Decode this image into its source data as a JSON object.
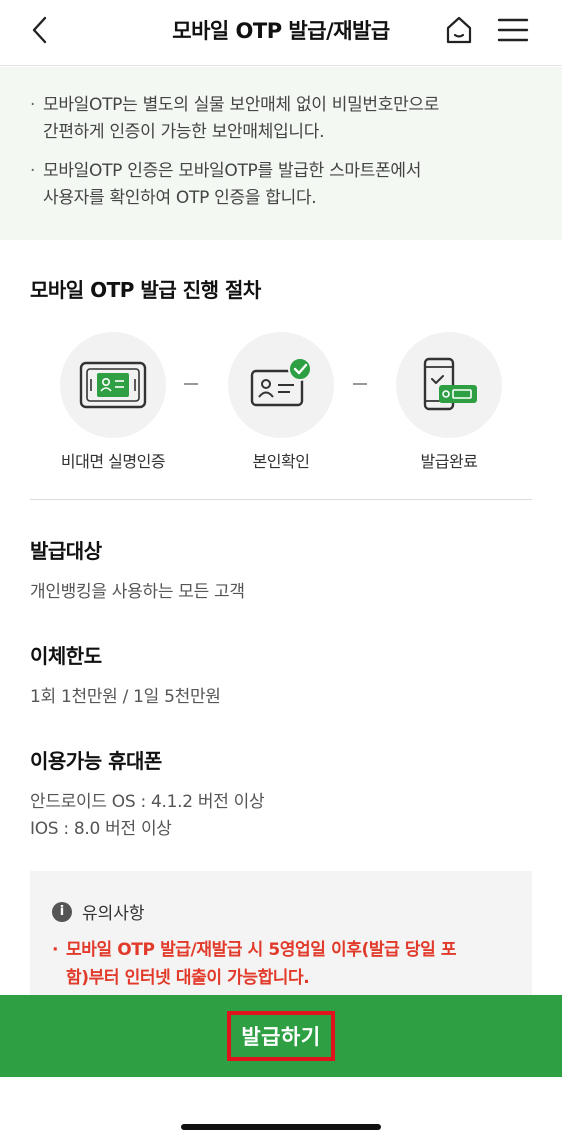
{
  "header": {
    "title": "모바일 OTP 발급/재발급",
    "icons": {
      "back": "chevron-left-icon",
      "home": "home-icon",
      "menu": "hamburger-menu-icon"
    }
  },
  "notice": {
    "items": [
      {
        "line1": "모바일OTP는 별도의 실물 보안매체 없이 비밀번호만으로",
        "line2": "간편하게 인증이 가능한 보안매체입니다."
      },
      {
        "line1": "모바일OTP 인증은 모바일OTP를 발급한 스마트폰에서",
        "line2": "사용자를 확인하여 OTP 인증을 합니다."
      }
    ]
  },
  "procedure": {
    "title": "모바일 OTP 발급 진행 절차",
    "steps": [
      {
        "label": "비대면 실명인증",
        "icon": "id-card-scan-icon"
      },
      {
        "label": "본인확인",
        "icon": "id-card-check-icon"
      },
      {
        "label": "발급완료",
        "icon": "phone-otp-icon"
      }
    ]
  },
  "target": {
    "title": "발급대상",
    "text": "개인뱅킹을 사용하는 모든 고객"
  },
  "limit": {
    "title": "이체한도",
    "text": "1회 1천만원 / 1일 5천만원"
  },
  "phones": {
    "title": "이용가능 휴대폰",
    "line1": "안드로이드 OS : 4.1.2 버전 이상",
    "line2": "IOS : 8.0 버전 이상"
  },
  "caution": {
    "title": "유의사항",
    "icon": "info-icon",
    "text_line1": "모바일 OTP 발급/재발급 시 5영업일 이후(발급 당일 포",
    "text_line2": "함)부터 인터넷 대출이 가능합니다."
  },
  "cta": {
    "label": "발급하기"
  },
  "colors": {
    "brand_green": "#2ea043",
    "caution_red": "#e23a2a",
    "highlight_red": "#e0141d"
  }
}
